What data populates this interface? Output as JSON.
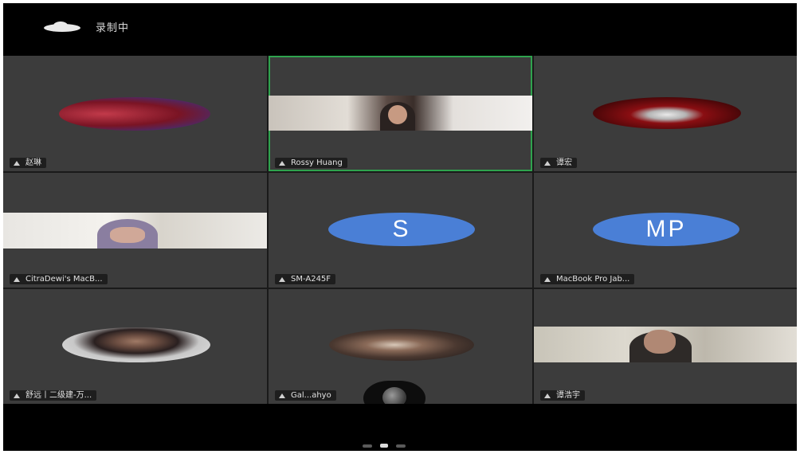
{
  "status_bar": {
    "recording_text": "录制中"
  },
  "participants": [
    {
      "name": "赵琳",
      "display": "avatar",
      "active": false
    },
    {
      "name": "Rossy Huang",
      "display": "video",
      "active": true
    },
    {
      "name": "谭宏",
      "display": "avatar",
      "active": false
    },
    {
      "name": "CitraDewi's MacB...",
      "display": "video",
      "active": false
    },
    {
      "name": "SM-A245F",
      "display": "initials",
      "initials": "S",
      "active": false
    },
    {
      "name": "MacBook Pro Jab...",
      "display": "initials",
      "initials": "MP",
      "active": false
    },
    {
      "name": "舒远丨二级建-万...",
      "display": "avatar",
      "active": false
    },
    {
      "name": "Gal...ahyo",
      "display": "avatar",
      "active": false
    },
    {
      "name": "谭浩宇",
      "display": "video",
      "active": false
    }
  ],
  "pager": {
    "pages": 3,
    "current": 2
  },
  "colors": {
    "active_border": "#2fa34e",
    "initials_bg": "#4a7fd6",
    "tile_bg": "#3c3c3c"
  }
}
